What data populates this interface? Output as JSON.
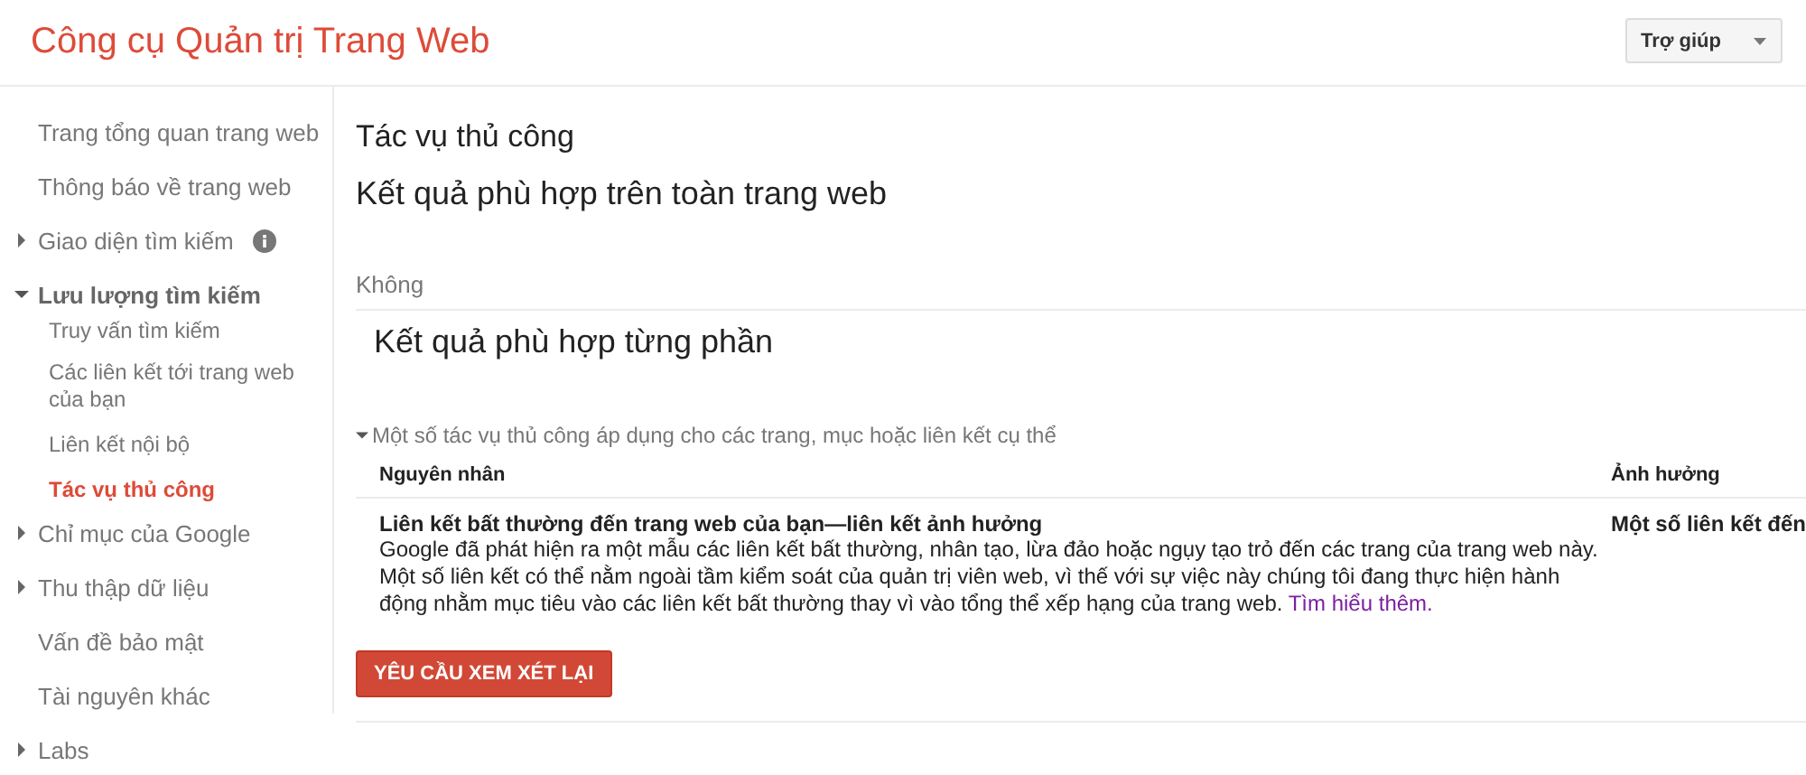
{
  "header": {
    "title": "Công cụ Quản trị Trang Web",
    "help_button": "Trợ giúp"
  },
  "sidebar": {
    "items": [
      {
        "label": "Trang tổng quan trang web",
        "selected": false
      },
      {
        "label": "Thông báo về trang web",
        "selected": false
      },
      {
        "label": "Giao diện tìm kiếm",
        "selected": false,
        "expanded": false,
        "info": true
      },
      {
        "label": "Lưu lượng tìm kiếm",
        "selected": false,
        "expanded": true,
        "children": [
          {
            "label": "Truy vấn tìm kiếm",
            "selected": false
          },
          {
            "label": "Các liên kết tới trang web của bạn",
            "selected": false
          },
          {
            "label": "Liên kết nội bộ",
            "selected": false
          },
          {
            "label": "Tác vụ thủ công",
            "selected": true
          }
        ]
      },
      {
        "label": "Chỉ mục của Google",
        "selected": false,
        "expanded": false
      },
      {
        "label": "Thu thập dữ liệu",
        "selected": false,
        "expanded": false
      },
      {
        "label": "Vấn đề bảo mật",
        "selected": false
      },
      {
        "label": "Tài nguyên khác",
        "selected": false
      },
      {
        "label": "Labs",
        "selected": false,
        "expanded": false
      }
    ]
  },
  "main": {
    "title": "Tác vụ thủ công",
    "site_wide_heading": "Kết quả phù hợp trên toàn trang web",
    "site_wide_value": "Không",
    "partial_heading": "Kết quả phù hợp từng phần",
    "partial_section": {
      "label": "Một số tác vụ thủ công áp dụng cho các trang, mục hoặc liên kết cụ thể",
      "expanded": true,
      "table": {
        "columns": [
          "Nguyên nhân",
          "Ảnh hưởng"
        ],
        "rows": [
          {
            "reason_title": "Liên kết bất thường đến trang web của bạn—liên kết ảnh hưởng",
            "reason_text": "Google đã phát hiện ra một mẫu các liên kết bất thường, nhân tạo, lừa đảo hoặc ngụy tạo trỏ đến các trang của trang web này. Một số liên kết có thể nằm ngoài tầm kiểm soát của quản trị viên web, vì thế với sự việc này chúng tôi đang thực hiện hành động nhằm mục tiêu vào các liên kết bất thường thay vì vào tổng thể xếp hạng của trang web.",
            "link": "Tìm hiểu thêm.",
            "impact": "Một số liên kết đến"
          }
        ]
      }
    },
    "review_button": "YÊU CẦU XEM XÉT LẠI"
  }
}
